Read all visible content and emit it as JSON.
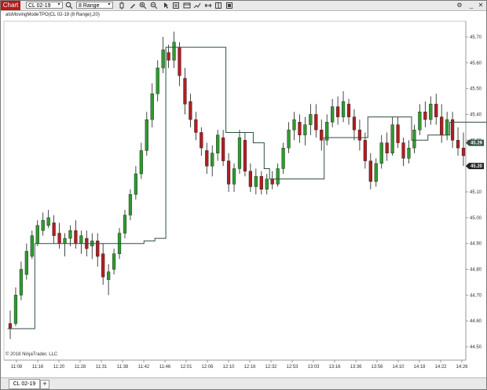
{
  "window": {
    "chart_tab": "Chart",
    "instrument": "CL 02-19",
    "bar_type": "8 Range",
    "indicator_label": "atsMovingModeTPO(CL 02-19 (8 Range),20)",
    "copyright": "© 2018 NinjaTrader, LLC",
    "bottom_tab": "CL 02-19",
    "add_tab": "+"
  },
  "toolbar_icons": [
    "search-icon",
    "bar-type-dropdown",
    "pencil-icon",
    "zoom-in-icon",
    "zoom-out-icon",
    "pointer-icon",
    "properties-icon",
    "templates-icon",
    "strategies-icon",
    "scroll-icon",
    "chart-trader-icon",
    "data-box-icon",
    "settings-icon"
  ],
  "colors": {
    "up": "#2e9a2e",
    "down": "#b01e22",
    "line": "#2f4f3f",
    "price_tag": "#222222",
    "chart_tab": "#b01d1d"
  },
  "chart_data": {
    "type": "candlestick",
    "y_ticks": [
      "45.70",
      "45.60",
      "45.50",
      "45.40",
      "45.30",
      "45.20",
      "45.10",
      "45.00",
      "44.90",
      "44.80",
      "44.70",
      "44.60",
      "44.50"
    ],
    "x_ticks": [
      "11:08",
      "11:16",
      "11:20",
      "11:28",
      "11:31",
      "11:38",
      "11:42",
      "11:46",
      "12:01",
      "12:06",
      "12:10",
      "12:16",
      "12:32",
      "12:53",
      "13:03",
      "13:16",
      "13:36",
      "13:56",
      "14:10",
      "14:18",
      "14:22",
      "14:26"
    ],
    "ylim": [
      44.47,
      45.74
    ],
    "price_tags": [
      {
        "label": "45.29",
        "value": 45.29
      },
      {
        "label": "45.20",
        "value": 45.2
      }
    ],
    "candles": [
      {
        "o": 44.59,
        "h": 44.64,
        "l": 44.53,
        "c": 44.57
      },
      {
        "o": 44.59,
        "h": 44.73,
        "l": 44.58,
        "c": 44.7
      },
      {
        "o": 44.7,
        "h": 44.83,
        "l": 44.68,
        "c": 44.8
      },
      {
        "o": 44.78,
        "h": 44.9,
        "l": 44.76,
        "c": 44.87
      },
      {
        "o": 44.85,
        "h": 44.95,
        "l": 44.84,
        "c": 44.93
      },
      {
        "o": 44.9,
        "h": 44.99,
        "l": 44.89,
        "c": 44.97
      },
      {
        "o": 44.95,
        "h": 45.02,
        "l": 44.93,
        "c": 44.99
      },
      {
        "o": 44.97,
        "h": 45.03,
        "l": 44.96,
        "c": 45.0
      },
      {
        "o": 44.98,
        "h": 45.01,
        "l": 44.9,
        "c": 44.93
      },
      {
        "o": 44.94,
        "h": 44.98,
        "l": 44.88,
        "c": 44.9
      },
      {
        "o": 44.9,
        "h": 44.94,
        "l": 44.85,
        "c": 44.92
      },
      {
        "o": 44.92,
        "h": 44.97,
        "l": 44.89,
        "c": 44.95
      },
      {
        "o": 44.95,
        "h": 44.99,
        "l": 44.88,
        "c": 44.9
      },
      {
        "o": 44.9,
        "h": 44.95,
        "l": 44.86,
        "c": 44.93
      },
      {
        "o": 44.92,
        "h": 44.95,
        "l": 44.85,
        "c": 44.88
      },
      {
        "o": 44.89,
        "h": 44.94,
        "l": 44.84,
        "c": 44.91
      },
      {
        "o": 44.91,
        "h": 44.94,
        "l": 44.81,
        "c": 44.85
      },
      {
        "o": 44.86,
        "h": 44.9,
        "l": 44.74,
        "c": 44.77
      },
      {
        "o": 44.76,
        "h": 44.82,
        "l": 44.7,
        "c": 44.79
      },
      {
        "o": 44.8,
        "h": 44.88,
        "l": 44.78,
        "c": 44.86
      },
      {
        "o": 44.86,
        "h": 44.96,
        "l": 44.84,
        "c": 44.94
      },
      {
        "o": 44.94,
        "h": 45.03,
        "l": 44.92,
        "c": 45.01
      },
      {
        "o": 45.01,
        "h": 45.11,
        "l": 44.99,
        "c": 45.09
      },
      {
        "o": 45.09,
        "h": 45.2,
        "l": 45.07,
        "c": 45.17
      },
      {
        "o": 45.17,
        "h": 45.29,
        "l": 45.15,
        "c": 45.26
      },
      {
        "o": 45.26,
        "h": 45.41,
        "l": 45.24,
        "c": 45.38
      },
      {
        "o": 45.38,
        "h": 45.52,
        "l": 45.35,
        "c": 45.48
      },
      {
        "o": 45.48,
        "h": 45.61,
        "l": 45.45,
        "c": 45.58
      },
      {
        "o": 45.58,
        "h": 45.7,
        "l": 45.56,
        "c": 45.65
      },
      {
        "o": 45.64,
        "h": 45.67,
        "l": 45.58,
        "c": 45.61
      },
      {
        "o": 45.61,
        "h": 45.72,
        "l": 45.58,
        "c": 45.68
      },
      {
        "o": 45.66,
        "h": 45.68,
        "l": 45.51,
        "c": 45.55
      },
      {
        "o": 45.54,
        "h": 45.58,
        "l": 45.4,
        "c": 45.44
      },
      {
        "o": 45.45,
        "h": 45.48,
        "l": 45.35,
        "c": 45.38
      },
      {
        "o": 45.38,
        "h": 45.41,
        "l": 45.3,
        "c": 45.33
      },
      {
        "o": 45.33,
        "h": 45.35,
        "l": 45.24,
        "c": 45.27
      },
      {
        "o": 45.26,
        "h": 45.29,
        "l": 45.17,
        "c": 45.2
      },
      {
        "o": 45.2,
        "h": 45.28,
        "l": 45.16,
        "c": 45.25
      },
      {
        "o": 45.25,
        "h": 45.34,
        "l": 45.22,
        "c": 45.32
      },
      {
        "o": 45.31,
        "h": 45.34,
        "l": 45.2,
        "c": 45.22
      },
      {
        "o": 45.22,
        "h": 45.25,
        "l": 45.1,
        "c": 45.13
      },
      {
        "o": 45.13,
        "h": 45.21,
        "l": 45.1,
        "c": 45.19
      },
      {
        "o": 45.19,
        "h": 45.34,
        "l": 45.17,
        "c": 45.31
      },
      {
        "o": 45.3,
        "h": 45.33,
        "l": 45.16,
        "c": 45.18
      },
      {
        "o": 45.18,
        "h": 45.21,
        "l": 45.1,
        "c": 45.12
      },
      {
        "o": 45.12,
        "h": 45.19,
        "l": 45.09,
        "c": 45.16
      },
      {
        "o": 45.16,
        "h": 45.18,
        "l": 45.09,
        "c": 45.11
      },
      {
        "o": 45.11,
        "h": 45.17,
        "l": 45.09,
        "c": 45.15
      },
      {
        "o": 45.15,
        "h": 45.18,
        "l": 45.11,
        "c": 45.13
      },
      {
        "o": 45.13,
        "h": 45.21,
        "l": 45.12,
        "c": 45.19
      },
      {
        "o": 45.19,
        "h": 45.29,
        "l": 45.17,
        "c": 45.27
      },
      {
        "o": 45.27,
        "h": 45.37,
        "l": 45.25,
        "c": 45.34
      },
      {
        "o": 45.34,
        "h": 45.41,
        "l": 45.3,
        "c": 45.38
      },
      {
        "o": 45.37,
        "h": 45.4,
        "l": 45.29,
        "c": 45.32
      },
      {
        "o": 45.32,
        "h": 45.39,
        "l": 45.28,
        "c": 45.36
      },
      {
        "o": 45.36,
        "h": 45.44,
        "l": 45.32,
        "c": 45.4
      },
      {
        "o": 45.4,
        "h": 45.44,
        "l": 45.31,
        "c": 45.34
      },
      {
        "o": 45.34,
        "h": 45.38,
        "l": 45.26,
        "c": 45.3
      },
      {
        "o": 45.3,
        "h": 45.4,
        "l": 45.28,
        "c": 45.37
      },
      {
        "o": 45.37,
        "h": 45.46,
        "l": 45.35,
        "c": 45.43
      },
      {
        "o": 45.43,
        "h": 45.47,
        "l": 45.36,
        "c": 45.39
      },
      {
        "o": 45.39,
        "h": 45.49,
        "l": 45.37,
        "c": 45.45
      },
      {
        "o": 45.44,
        "h": 45.46,
        "l": 45.36,
        "c": 45.39
      },
      {
        "o": 45.39,
        "h": 45.42,
        "l": 45.3,
        "c": 45.34
      },
      {
        "o": 45.34,
        "h": 45.38,
        "l": 45.26,
        "c": 45.3
      },
      {
        "o": 45.3,
        "h": 45.33,
        "l": 45.19,
        "c": 45.22
      },
      {
        "o": 45.22,
        "h": 45.25,
        "l": 45.11,
        "c": 45.14
      },
      {
        "o": 45.14,
        "h": 45.23,
        "l": 45.12,
        "c": 45.21
      },
      {
        "o": 45.21,
        "h": 45.32,
        "l": 45.19,
        "c": 45.29
      },
      {
        "o": 45.29,
        "h": 45.33,
        "l": 45.22,
        "c": 45.25
      },
      {
        "o": 45.25,
        "h": 45.39,
        "l": 45.24,
        "c": 45.36
      },
      {
        "o": 45.36,
        "h": 45.39,
        "l": 45.27,
        "c": 45.29
      },
      {
        "o": 45.29,
        "h": 45.31,
        "l": 45.2,
        "c": 45.23
      },
      {
        "o": 45.23,
        "h": 45.3,
        "l": 45.21,
        "c": 45.27
      },
      {
        "o": 45.27,
        "h": 45.36,
        "l": 45.25,
        "c": 45.34
      },
      {
        "o": 45.34,
        "h": 45.44,
        "l": 45.32,
        "c": 45.41
      },
      {
        "o": 45.41,
        "h": 45.45,
        "l": 45.35,
        "c": 45.38
      },
      {
        "o": 45.38,
        "h": 45.47,
        "l": 45.36,
        "c": 45.44
      },
      {
        "o": 45.44,
        "h": 45.48,
        "l": 45.36,
        "c": 45.39
      },
      {
        "o": 45.39,
        "h": 45.44,
        "l": 45.29,
        "c": 45.32
      },
      {
        "o": 45.32,
        "h": 45.41,
        "l": 45.3,
        "c": 45.38
      },
      {
        "o": 45.38,
        "h": 45.41,
        "l": 45.27,
        "c": 45.3
      },
      {
        "o": 45.3,
        "h": 45.35,
        "l": 45.24,
        "c": 45.27
      },
      {
        "o": 45.27,
        "h": 45.33,
        "l": 45.2,
        "c": 45.24
      }
    ],
    "series": [
      {
        "values": [
          44.57,
          44.57,
          44.57,
          44.57,
          44.57,
          44.9,
          44.9,
          44.9,
          44.9,
          44.9,
          44.9,
          44.9,
          44.9,
          44.9,
          44.9,
          44.9,
          44.9,
          44.9,
          44.9,
          44.9,
          44.9,
          44.9,
          44.9,
          44.9,
          44.9,
          44.91,
          44.91,
          44.92,
          44.92,
          45.66,
          45.66,
          45.66,
          45.66,
          45.66,
          45.66,
          45.66,
          45.66,
          45.66,
          45.66,
          45.66,
          45.33,
          45.33,
          45.33,
          45.33,
          45.33,
          45.29,
          45.29,
          45.19,
          45.15,
          45.15,
          45.15,
          45.15,
          45.15,
          45.15,
          45.15,
          45.15,
          45.15,
          45.15,
          45.31,
          45.31,
          45.31,
          45.31,
          45.31,
          45.31,
          45.31,
          45.31,
          45.39,
          45.39,
          45.39,
          45.39,
          45.39,
          45.39,
          45.39,
          45.39,
          45.3,
          45.3,
          45.3,
          45.32,
          45.32,
          45.32,
          45.32,
          45.37,
          45.37,
          45.37,
          45.37,
          45.37,
          45.37,
          45.37,
          45.37,
          45.32,
          45.32,
          45.32,
          45.32,
          45.32,
          45.32
        ]
      }
    ]
  }
}
